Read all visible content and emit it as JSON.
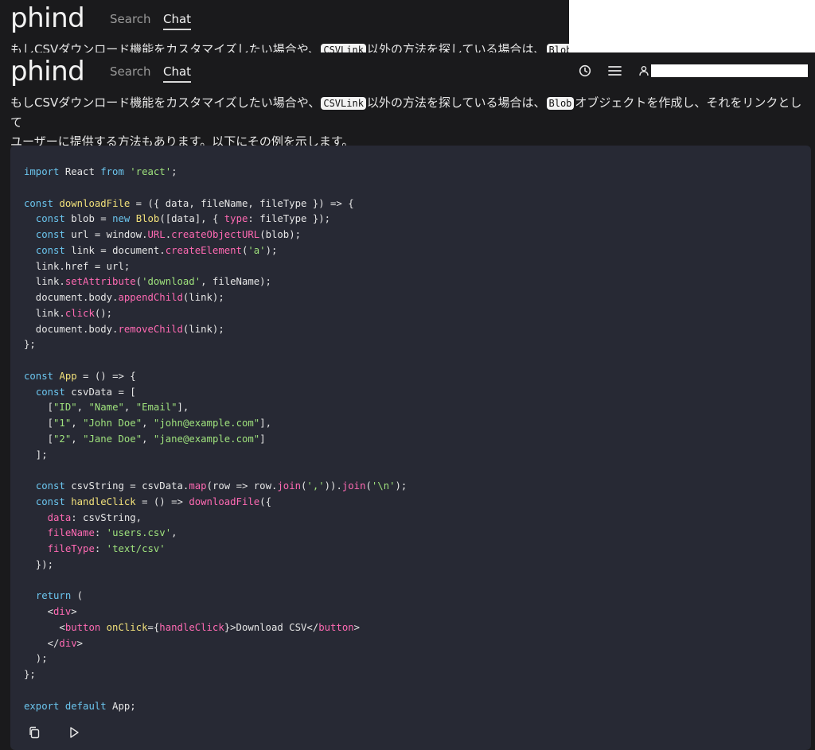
{
  "app": {
    "logo": "phind",
    "nav": [
      {
        "label": "Search",
        "active": false
      },
      {
        "label": "Chat",
        "active": true
      }
    ]
  },
  "message": {
    "line1_part1": "もしCSVダウンロード機能をカスタマイズしたい場合や、",
    "code1": "CSVLink",
    "line1_part2": "以外の方法を探している場合は、",
    "code2": "Blob",
    "line1_part3": "オブジェクトを作成し、それをリンクとして",
    "line2": "ユーザーに提供する方法もあります。以下にその例を示します。"
  },
  "header_icons": [
    "history-icon",
    "menu-icon",
    "user-icon"
  ],
  "code": {
    "language": "jsx",
    "lines": [
      "import React from 'react';",
      "",
      "const downloadFile = ({ data, fileName, fileType }) => {",
      "  const blob = new Blob([data], { type: fileType });",
      "  const url = window.URL.createObjectURL(blob);",
      "  const link = document.createElement('a');",
      "  link.href = url;",
      "  link.setAttribute('download', fileName);",
      "  document.body.appendChild(link);",
      "  link.click();",
      "  document.body.removeChild(link);",
      "};",
      "",
      "const App = () => {",
      "  const csvData = [",
      "    [\"ID\", \"Name\", \"Email\"],",
      "    [\"1\", \"John Doe\", \"john@example.com\"],",
      "    [\"2\", \"Jane Doe\", \"jane@example.com\"]",
      "  ];",
      "",
      "  const csvString = csvData.map(row => row.join(',')).join('\\n');",
      "  const handleClick = () => downloadFile({",
      "    data: csvString,",
      "    fileName: 'users.csv',",
      "    fileType: 'text/csv'",
      "  });",
      "",
      "  return (",
      "    <div>",
      "      <button onClick={handleClick}>Download CSV</button>",
      "    </div>",
      "  );",
      "};",
      "",
      "export default App;"
    ]
  },
  "code_actions": [
    "copy-icon",
    "run-icon"
  ]
}
